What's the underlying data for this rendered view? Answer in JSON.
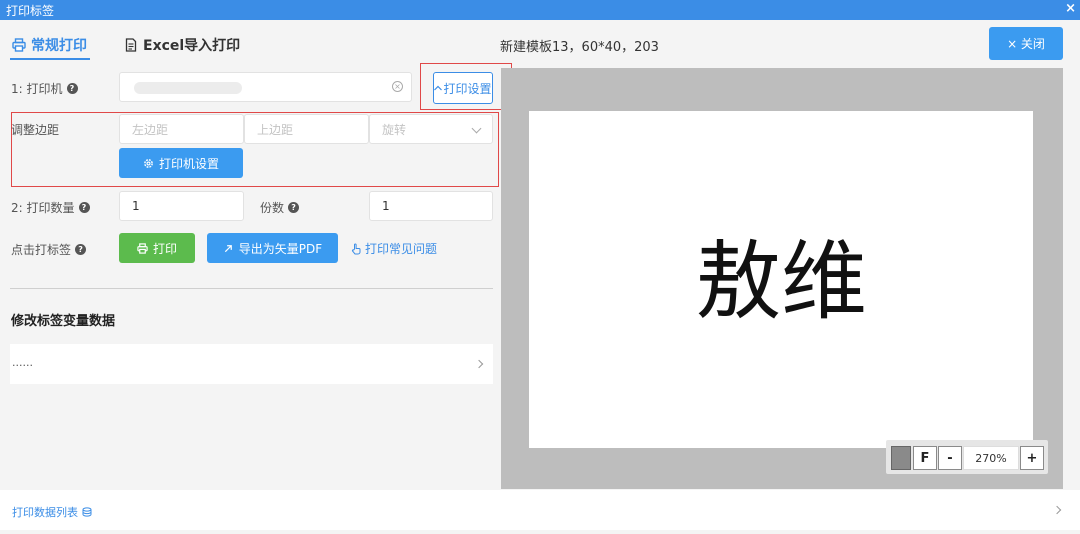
{
  "window": {
    "title": "打印标签",
    "close_glyph": "×"
  },
  "tabs": [
    {
      "label": "常规打印",
      "icon": "printer-icon",
      "active": true
    },
    {
      "label": "Excel导入打印",
      "icon": "document-icon",
      "active": false
    }
  ],
  "template_name": "新建模板13，60*40，203",
  "close_button": {
    "label": "× 关闭"
  },
  "printer": {
    "label": "1: 打印机",
    "value": "",
    "settings_button": "打印设置",
    "settings_icon": "chevron-up-icon"
  },
  "margins": {
    "label": "调整边距",
    "left_placeholder": "左边距",
    "top_placeholder": "上边距",
    "rotate_placeholder": "旋转",
    "printer_setup_button": "打印机设置"
  },
  "quantity": {
    "label": "2: 打印数量",
    "value": "1",
    "copies_label": "份数",
    "copies_value": "1"
  },
  "actions": {
    "label": "点击打标签",
    "print_button": "打印",
    "export_pdf_button": "导出为矢量PDF",
    "faq_link": "打印常见问题"
  },
  "variables": {
    "title": "修改标签变量数据",
    "row_text": "......"
  },
  "bottom": {
    "label": "打印数据列表"
  },
  "preview": {
    "label_text": "敖维"
  },
  "zoom": {
    "fit": "F",
    "minus": "-",
    "value": "270%",
    "plus": "+"
  },
  "colors": {
    "accent": "#3b8de6",
    "button_blue": "#3b9bf0",
    "button_green": "#5cbb4d",
    "highlight_red": "#e04848"
  }
}
